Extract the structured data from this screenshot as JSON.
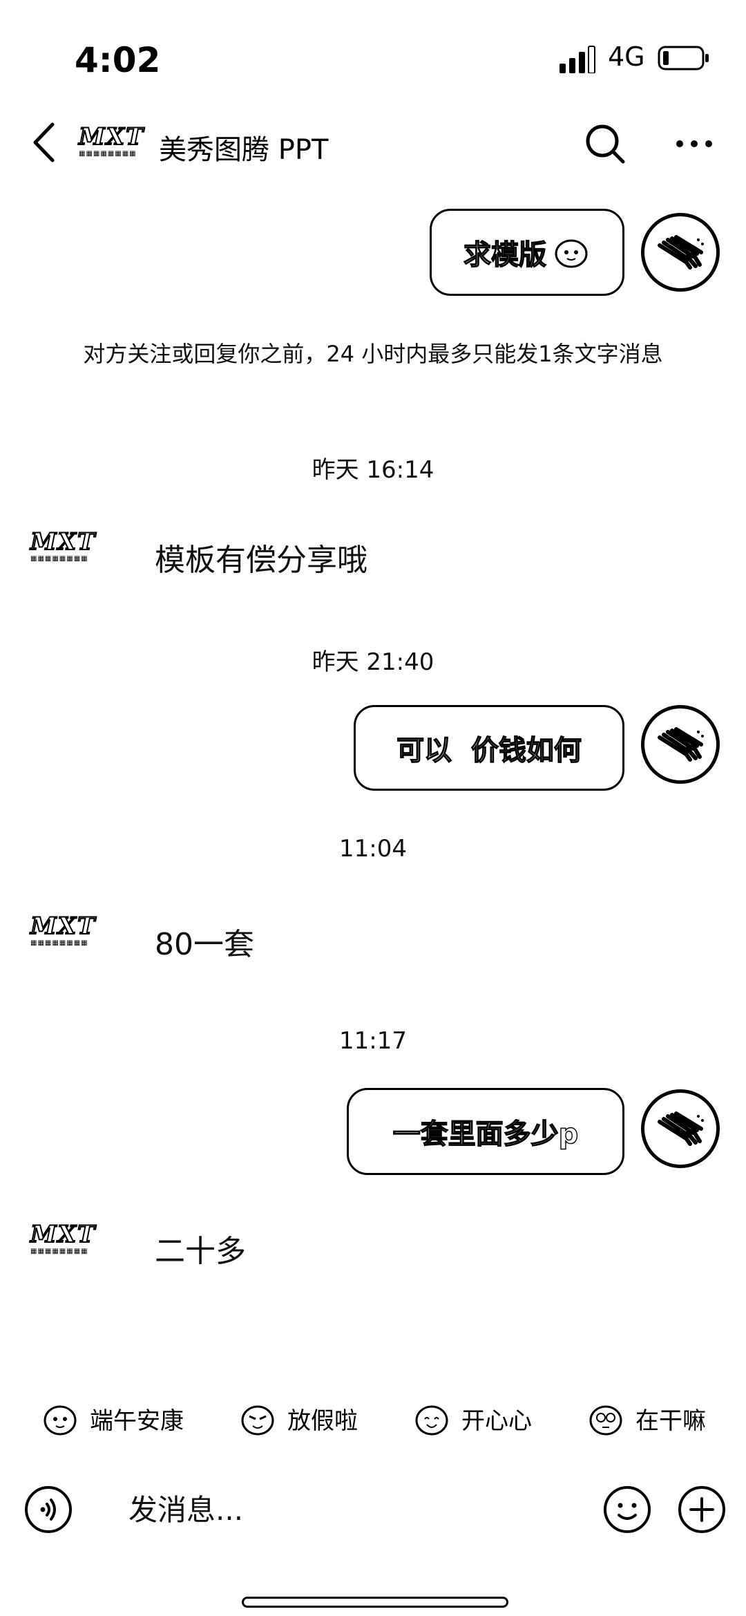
{
  "status_bar": {
    "time": "4:02",
    "network": "4G"
  },
  "header": {
    "contact_name": "美秀图腾 PPT",
    "logo_text": "MXT",
    "back_icon": "chevron-left-icon",
    "search_icon": "search-icon",
    "more_icon": "more-icon"
  },
  "messages": {
    "out1": "求模版",
    "notice": "对方关注或回复你之前，24 小时内最多只能发1条文字消息",
    "ts1": "昨天 16:14",
    "in1": "模板有偿分享哦",
    "ts2": "昨天 21:40",
    "out2": "可以  价钱如何",
    "ts3": "11:04",
    "in2": "80一套",
    "ts4": "11:17",
    "out3": "一套里面多少p",
    "in3": "二十多"
  },
  "quick_replies": [
    {
      "label": "端午安康",
      "icon": "sticker-icon"
    },
    {
      "label": "放假啦",
      "icon": "sticker-icon"
    },
    {
      "label": "开心心",
      "icon": "sticker-icon"
    },
    {
      "label": "在干嘛",
      "icon": "sticker-icon"
    }
  ],
  "input_bar": {
    "placeholder": "发消息...",
    "voice_icon": "voice-icon",
    "emoji_icon": "smile-icon",
    "plus_icon": "plus-icon"
  }
}
